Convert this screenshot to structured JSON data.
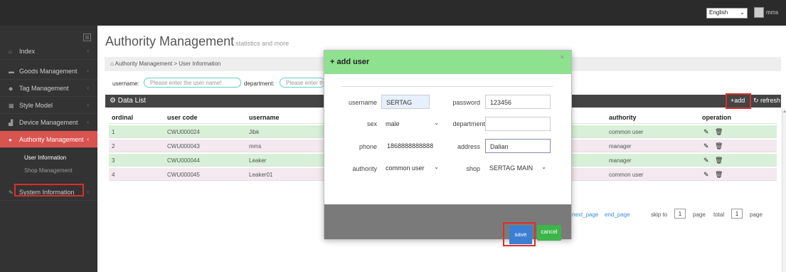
{
  "topbar": {
    "language": "English",
    "user": "mms"
  },
  "sidebar": {
    "items": [
      {
        "label": "Index",
        "icon": "home-icon"
      },
      {
        "label": "Goods Management",
        "icon": "folder-icon"
      },
      {
        "label": "Tag Management",
        "icon": "tag-icon"
      },
      {
        "label": "Style Model",
        "icon": "grid-icon"
      },
      {
        "label": "Device Management",
        "icon": "bar-chart-icon"
      },
      {
        "label": "Authority Management",
        "icon": "user-icon",
        "active": true
      },
      {
        "label": "System Information",
        "icon": "edit-icon"
      }
    ],
    "subitems": [
      {
        "label": "User Information",
        "selected": true
      },
      {
        "label": "Shop Management",
        "selected": false
      }
    ]
  },
  "page": {
    "title": "Authority Management",
    "subtitle": "statistics and more",
    "breadcrumb": "Authority Management  >  User Information",
    "filters": {
      "username_label": "username:",
      "username_placeholder": "Please enter the user name!",
      "department_label": "department:",
      "department_placeholder": "Please enter the"
    }
  },
  "list": {
    "title": "Data List",
    "add_label": "add",
    "refresh_label": "refresh",
    "columns": [
      "ordinal",
      "user code",
      "username",
      "authority",
      "operation"
    ],
    "rows": [
      {
        "ordinal": "1",
        "user_code": "CWU000024",
        "username": "Jibk",
        "authority": "common user"
      },
      {
        "ordinal": "2",
        "user_code": "CWU000043",
        "username": "mms",
        "authority": "manager"
      },
      {
        "ordinal": "3",
        "user_code": "CWU000044",
        "username": "Leaker",
        "authority": "manager"
      },
      {
        "ordinal": "4",
        "user_code": "CWU000045",
        "username": "Leaker01",
        "authority": "common user"
      }
    ]
  },
  "pager": {
    "next": "next_page",
    "end": "end_page",
    "skip": "skip to",
    "skip_value": "1",
    "page": "page",
    "total": "total",
    "total_value": "1",
    "page2": "page"
  },
  "modal": {
    "title": "+ add user",
    "close": "×",
    "fields": {
      "username_label": "username",
      "username_value": "SERTAG",
      "password_label": "password",
      "password_value": "123456",
      "sex_label": "sex",
      "sex_value": "male",
      "department_label": "department",
      "department_value": "",
      "phone_label": "phone",
      "phone_value": "1868888888888",
      "address_label": "address",
      "address_value": "Dalian",
      "authority_label": "authority",
      "authority_value": "common user",
      "shop_label": "shop",
      "shop_value": "SERTAG MAIN"
    },
    "save": "save",
    "cancel": "cancel"
  },
  "colors": {
    "accent": "#d9534f",
    "modal_header": "#8ee18e",
    "row_even": "#d7f0d7",
    "row_odd": "#f3e9ee",
    "save": "#3a7fd4",
    "cancel": "#3cb54a"
  }
}
